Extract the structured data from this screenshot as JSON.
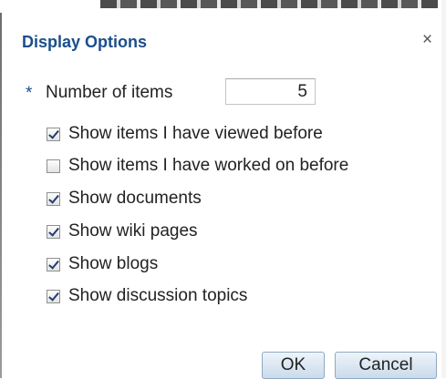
{
  "dialog": {
    "title": "Display Options",
    "close_glyph": "×",
    "required_marker": "*",
    "number_of_items_label": "Number of items",
    "number_of_items_value": "5",
    "options": [
      {
        "label": "Show items I have viewed before",
        "checked": true
      },
      {
        "label": "Show items I have worked on before",
        "checked": false
      },
      {
        "label": "Show documents",
        "checked": true
      },
      {
        "label": "Show wiki pages",
        "checked": true
      },
      {
        "label": "Show blogs",
        "checked": true
      },
      {
        "label": "Show discussion topics",
        "checked": true
      }
    ],
    "ok_label": "OK",
    "cancel_label": "Cancel"
  },
  "colors": {
    "title": "#1b4e8a",
    "button_border": "#8fa9c3",
    "button_bg_top": "#eef4fa",
    "button_bg_bottom": "#c9dbeb"
  },
  "icons": {
    "close": "close-icon",
    "checkbox_checked": "checkbox-checked-icon",
    "checkbox_unchecked": "checkbox-unchecked-icon"
  }
}
